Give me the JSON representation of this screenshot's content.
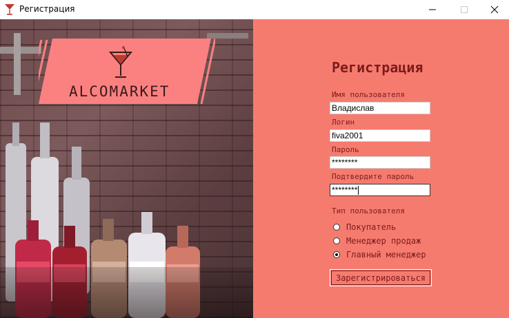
{
  "window": {
    "title": "Регистрация",
    "icon": "cocktail-glass-icon"
  },
  "logo": {
    "text": "ALCOMARKET",
    "icon": "martini-glass-icon"
  },
  "form": {
    "heading": "Регистрация",
    "fields": [
      {
        "label": "Имя пользователя",
        "value": "Владислав"
      },
      {
        "label": "Логин",
        "value": "fiva2001"
      },
      {
        "label": "Пароль",
        "value": "********"
      },
      {
        "label": "Подтвердите пароль",
        "value": "********"
      }
    ],
    "user_type_label": "Тип пользователя",
    "user_types": [
      {
        "label": "Покупатель",
        "checked": false
      },
      {
        "label": "Менеджер продаж",
        "checked": false
      },
      {
        "label": "Главный менеджер",
        "checked": true
      }
    ],
    "submit_label": "Зарегистрироваться"
  },
  "colors": {
    "panel": "#f67b6f",
    "text": "#7a1c1c",
    "logo_banner": "#fb8181"
  }
}
